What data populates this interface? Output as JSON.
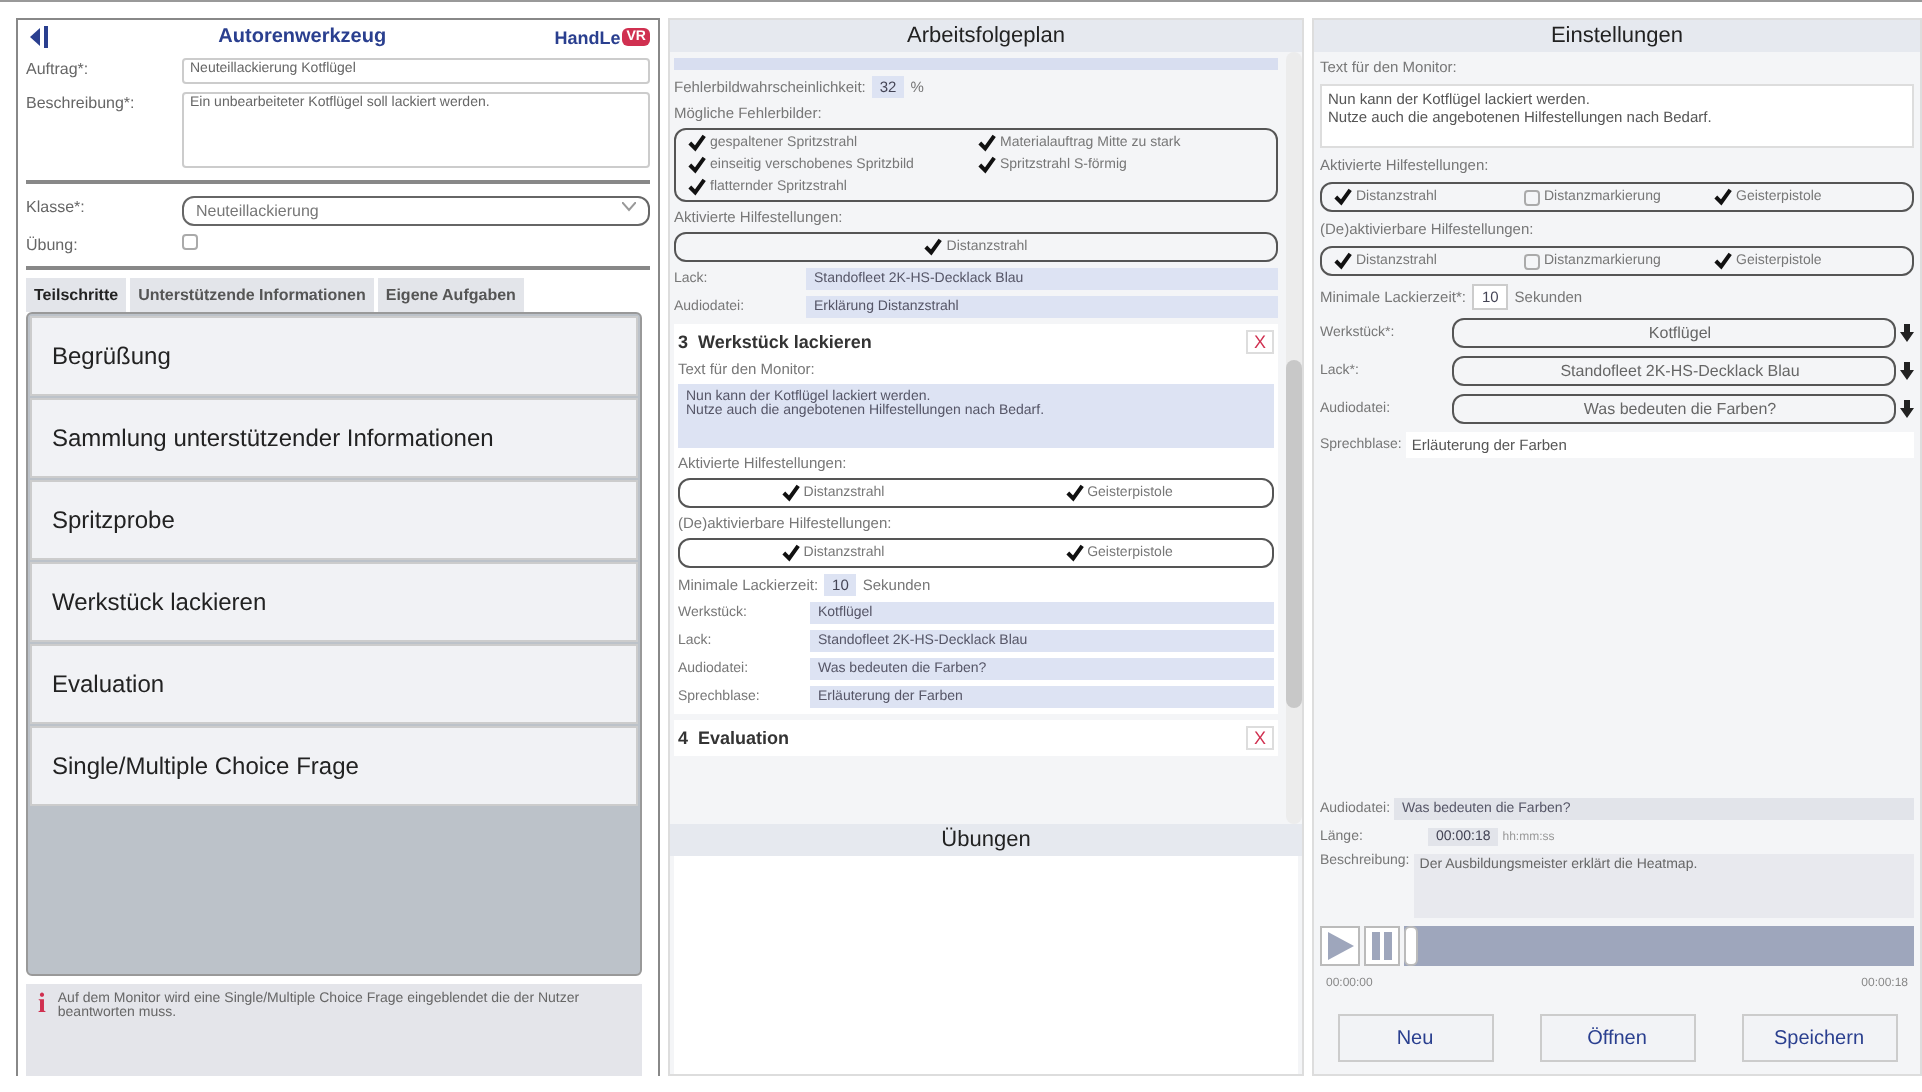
{
  "authoring": {
    "title": "Autorenwerkzeug",
    "logo_text": "HandLe",
    "logo_badge": "VR",
    "fields": [
      {
        "label": "Auftrag*:",
        "value": "Neuteillackierung Kotflügel"
      },
      {
        "label": "Beschreibung*:",
        "value": "Ein unbearbeiteter Kotflügel soll lackiert werden."
      }
    ],
    "klasse": {
      "label": "Klasse*:",
      "value": "Neuteillackierung"
    },
    "uebung": {
      "label": "Übung:",
      "checked": false
    },
    "tabs": [
      {
        "label": "Teilschritte",
        "selected": true
      },
      {
        "label": "Unterstützende Informationen",
        "selected": false
      },
      {
        "label": "Eigene Aufgaben",
        "selected": false
      }
    ],
    "steps": [
      {
        "label": "Begrüßung"
      },
      {
        "label": "Sammlung unterstützender Informationen"
      },
      {
        "label": "Spritzprobe"
      },
      {
        "label": "Werkstück lackieren"
      },
      {
        "label": "Evaluation"
      },
      {
        "label": "Single/Multiple Choice Frage"
      }
    ],
    "info_icon": "i",
    "info": "Auf dem Monitor wird eine Single/Multiple Choice Frage eingeblendet die der Nutzer beantworten muss."
  },
  "plan": {
    "title": "Arbeitsfolgeplan",
    "probability": {
      "label": "Fehlerbildwahrscheinlichkeit:",
      "value": "32",
      "unit": "%"
    },
    "faults_label": "Mögliche Fehlerbilder:",
    "faults": [
      {
        "label": "gespaltener Spritzstrahl",
        "checked": true
      },
      {
        "label": "Materialauftrag Mitte zu stark",
        "checked": true
      },
      {
        "label": "einseitig verschobenes Spritzbild",
        "checked": true
      },
      {
        "label": "Spritzstrahl S-förmig",
        "checked": true
      },
      {
        "label": "flatternder Spritzstrahl",
        "checked": true
      }
    ],
    "aids_label": "Aktivierte Hilfestellungen:",
    "aids": [
      {
        "label": "Distanzstrahl",
        "checked": true
      }
    ],
    "rows": [
      {
        "label": "Lack:",
        "value": "Standofleet 2K-HS-Decklack Blau"
      },
      {
        "label": "Audiodatei:",
        "value": "Erklärung Distanzstrahl"
      }
    ],
    "steps": [
      {
        "number": "3",
        "title": "Werkstück lackieren",
        "remove_label": "X",
        "monitor_label": "Text für den Monitor:",
        "monitor_text": "Nun kann der Kotflügel lackiert werden.\nNutze auch die angebotenen Hilfestellungen nach Bedarf.",
        "active_label": "Aktivierte Hilfestellungen:",
        "active": [
          {
            "label": "Distanzstrahl",
            "checked": true
          },
          {
            "label": "Geisterpistole",
            "checked": true
          }
        ],
        "toggle_label": "(De)aktivierbare Hilfestellungen:",
        "toggle": [
          {
            "label": "Distanzstrahl",
            "checked": true
          },
          {
            "label": "Geisterpistole",
            "checked": true
          }
        ],
        "time": {
          "label": "Minimale Lackierzeit:",
          "value": "10",
          "unit": "Sekunden"
        },
        "rows": [
          {
            "label": "Werkstück:",
            "value": "Kotflügel"
          },
          {
            "label": "Lack:",
            "value": "Standofleet 2K-HS-Decklack Blau"
          },
          {
            "label": "Audiodatei:",
            "value": "Was bedeuten die Farben?"
          },
          {
            "label": "Sprechblase:",
            "value": "Erläuterung der Farben"
          }
        ]
      },
      {
        "number": "4",
        "title": "Evaluation",
        "remove_label": "X"
      }
    ],
    "exercises_title": "Übungen"
  },
  "settings": {
    "title": "Einstellungen",
    "monitor_label": "Text für den Monitor:",
    "monitor_text": "Nun kann der Kotflügel lackiert werden.\nNutze auch die angebotenen Hilfestellungen nach Bedarf.",
    "active_label": "Aktivierte Hilfestellungen:",
    "active": [
      {
        "label": "Distanzstrahl",
        "checked": true
      },
      {
        "label": "Distanzmarkierung",
        "checked": false
      },
      {
        "label": "Geisterpistole",
        "checked": true
      }
    ],
    "toggle_label": "(De)aktivierbare Hilfestellungen:",
    "toggle": [
      {
        "label": "Distanzstrahl",
        "checked": true
      },
      {
        "label": "Distanzmarkierung",
        "checked": false
      },
      {
        "label": "Geisterpistole",
        "checked": true
      }
    ],
    "time": {
      "label": "Minimale Lackierzeit*:",
      "value": "10",
      "unit": "Sekunden"
    },
    "selects": [
      {
        "label": "Werkstück*:",
        "value": "Kotflügel"
      },
      {
        "label": "Lack*:",
        "value": "Standofleet 2K-HS-Decklack Blau"
      },
      {
        "label": "Audiodatei:",
        "value": "Was bedeuten die Farben?"
      }
    ],
    "bubble": {
      "label": "Sprechblase:",
      "value": "Erläuterung der Farben"
    },
    "audio": {
      "file_label": "Audiodatei:",
      "file": "Was bedeuten die Farben?",
      "length_label": "Länge:",
      "length": "00:00:18",
      "length_hint": "hh:mm:ss",
      "desc_label": "Beschreibung:",
      "desc": "Der Ausbildungsmeister erklärt die Heatmap.",
      "level": 0,
      "start": "00:00:00",
      "end": "00:00:18"
    },
    "buttons": [
      "Neu",
      "Öffnen",
      "Speichern"
    ]
  }
}
